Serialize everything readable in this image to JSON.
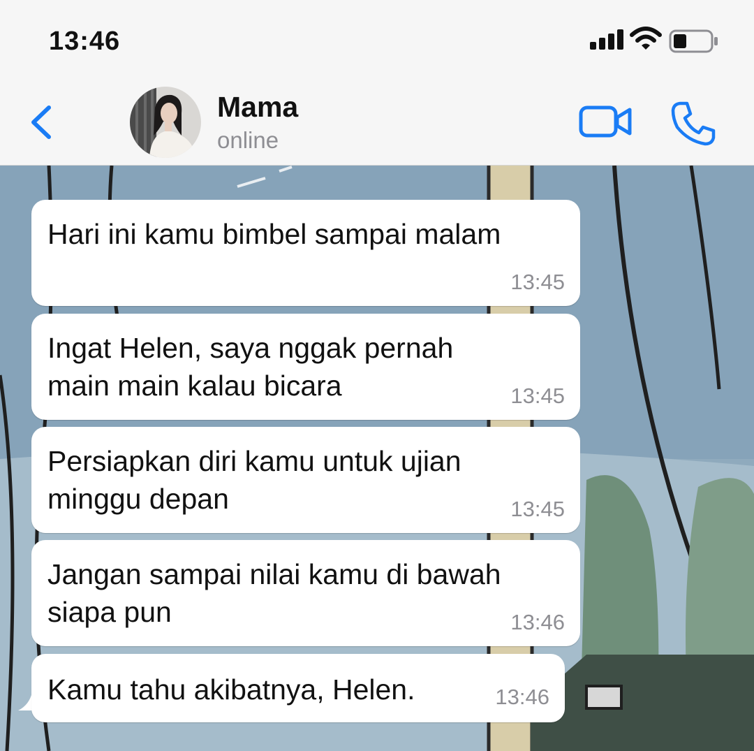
{
  "status_bar": {
    "time": "13:46",
    "signal_icon": "cellular-signal-icon",
    "wifi_icon": "wifi-icon",
    "battery_icon": "battery-icon",
    "battery_level": 0.35
  },
  "header": {
    "back_icon": "chevron-left-icon",
    "contact_name": "Mama",
    "contact_status": "online",
    "video_call_icon": "video-camera-icon",
    "voice_call_icon": "phone-icon"
  },
  "colors": {
    "accent": "#1a7cf5",
    "bubble_bg": "#ffffff",
    "time_text": "#8e8e93",
    "header_bg": "#f6f6f6",
    "wallpaper_sky": "#8faabd"
  },
  "messages": [
    {
      "text": "Hari ini kamu bimbel sampai malam",
      "time": "13:45"
    },
    {
      "text": "Ingat Helen, saya nggak pernah main main kalau bicara",
      "time": "13:45"
    },
    {
      "text": "Persiapkan diri kamu untuk ujian minggu depan",
      "time": "13:45"
    },
    {
      "text": "Jangan sampai nilai kamu di bawah siapa pun",
      "time": "13:46"
    },
    {
      "text": "Kamu tahu akibatnya, Helen.",
      "time": "13:46"
    }
  ]
}
